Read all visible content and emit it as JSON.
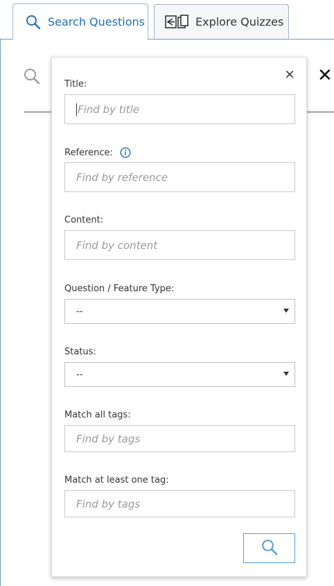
{
  "tabs": [
    {
      "label": "Search Questions",
      "icon": "search-icon",
      "active": true
    },
    {
      "label": "Explore Quizzes",
      "icon": "quizzes-icon",
      "active": false
    }
  ],
  "background": {
    "search_icon": "search-icon",
    "close_icon": "close-icon",
    "close_glyph": "✕"
  },
  "filter_popup": {
    "close_glyph": "×",
    "title": {
      "label": "Title:",
      "placeholder": "Find by title"
    },
    "reference": {
      "label": "Reference:",
      "placeholder": "Find by reference",
      "info_icon": "info-icon"
    },
    "content": {
      "label": "Content:",
      "placeholder": "Find by content"
    },
    "question_type": {
      "label": "Question / Feature Type:",
      "selected": "--"
    },
    "status": {
      "label": "Status:",
      "selected": "--"
    },
    "match_all_tags": {
      "label": "Match all tags:",
      "placeholder": "Find by tags"
    },
    "match_one_tag": {
      "label": "Match at least one tag:",
      "placeholder": "Find by tags"
    },
    "search_button_icon": "search-icon"
  },
  "colors": {
    "accent": "#1f6fb2",
    "info": "#2a78c2",
    "search_button_border": "#4f9fd6"
  }
}
